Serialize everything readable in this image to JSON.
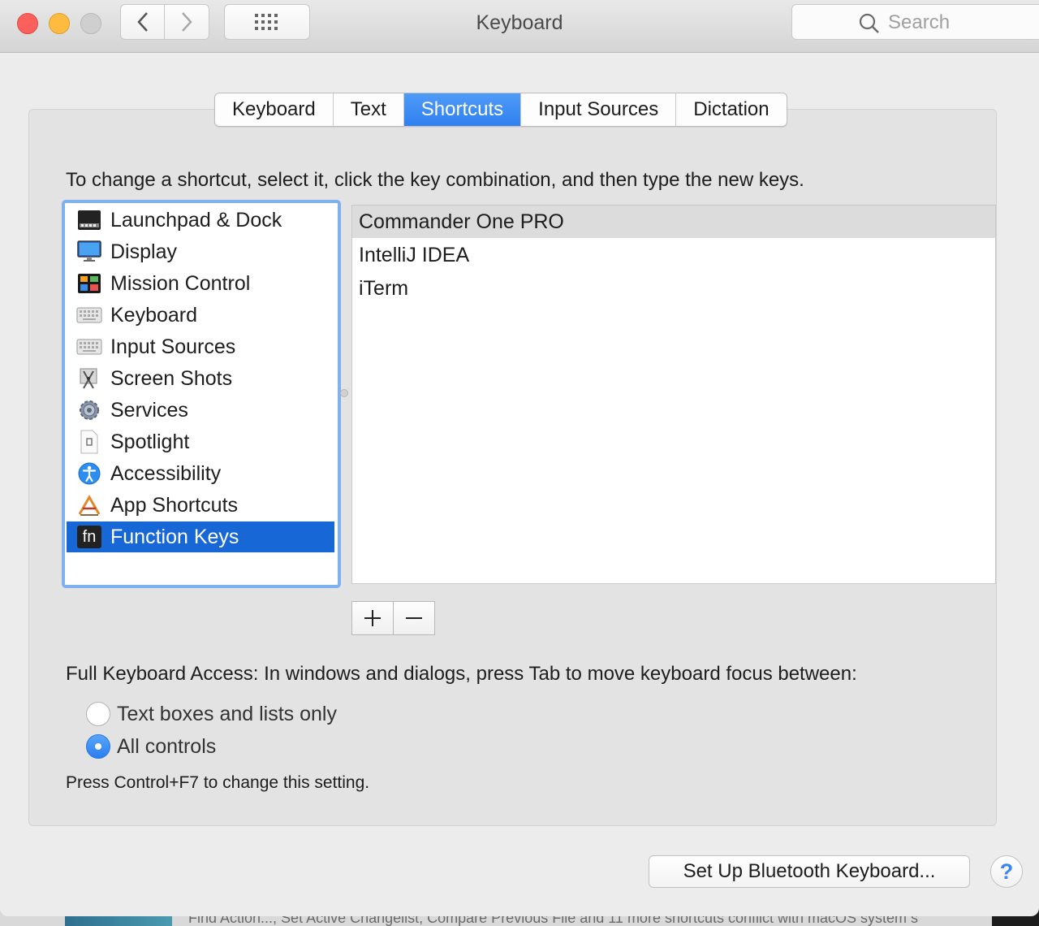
{
  "window": {
    "title": "Keyboard",
    "search_placeholder": "Search"
  },
  "tabs": [
    {
      "label": "Keyboard",
      "active": false
    },
    {
      "label": "Text",
      "active": false
    },
    {
      "label": "Shortcuts",
      "active": true
    },
    {
      "label": "Input Sources",
      "active": false
    },
    {
      "label": "Dictation",
      "active": false
    }
  ],
  "instruction": "To change a shortcut, select it, click the key combination, and then type the new keys.",
  "categories": [
    {
      "label": "Launchpad & Dock",
      "icon": "launchpad-dock-icon"
    },
    {
      "label": "Display",
      "icon": "display-icon"
    },
    {
      "label": "Mission Control",
      "icon": "mission-control-icon"
    },
    {
      "label": "Keyboard",
      "icon": "keyboard-icon"
    },
    {
      "label": "Input Sources",
      "icon": "input-sources-icon"
    },
    {
      "label": "Screen Shots",
      "icon": "screen-shots-icon"
    },
    {
      "label": "Services",
      "icon": "services-gear-icon"
    },
    {
      "label": "Spotlight",
      "icon": "spotlight-icon"
    },
    {
      "label": "Accessibility",
      "icon": "accessibility-icon"
    },
    {
      "label": "App Shortcuts",
      "icon": "app-shortcuts-icon"
    },
    {
      "label": "Function Keys",
      "icon": "fn-key-icon",
      "selected": true,
      "icon_text": "fn"
    }
  ],
  "apps": [
    {
      "label": "Commander One PRO",
      "selected": true
    },
    {
      "label": "IntelliJ IDEA",
      "selected": false
    },
    {
      "label": "iTerm",
      "selected": false
    }
  ],
  "add_button": "+",
  "remove_button": "—",
  "full_keyboard_access": {
    "title": "Full Keyboard Access: In windows and dialogs, press Tab to move keyboard focus between:",
    "options": [
      {
        "label": "Text boxes and lists only",
        "checked": false
      },
      {
        "label": "All controls",
        "checked": true
      }
    ],
    "hint": "Press Control+F7 to change this setting."
  },
  "bluetooth_button": "Set Up Bluetooth Keyboard...",
  "help_button": "?",
  "background_strip": "Find Action..., Set Active Changelist, Compare Previous File and 11 more shortcuts conflict with macOS system s",
  "colors": {
    "accent": "#2f80f0",
    "selection": "#1767d6",
    "close": "#fc605c",
    "minimize": "#fdbc40"
  }
}
